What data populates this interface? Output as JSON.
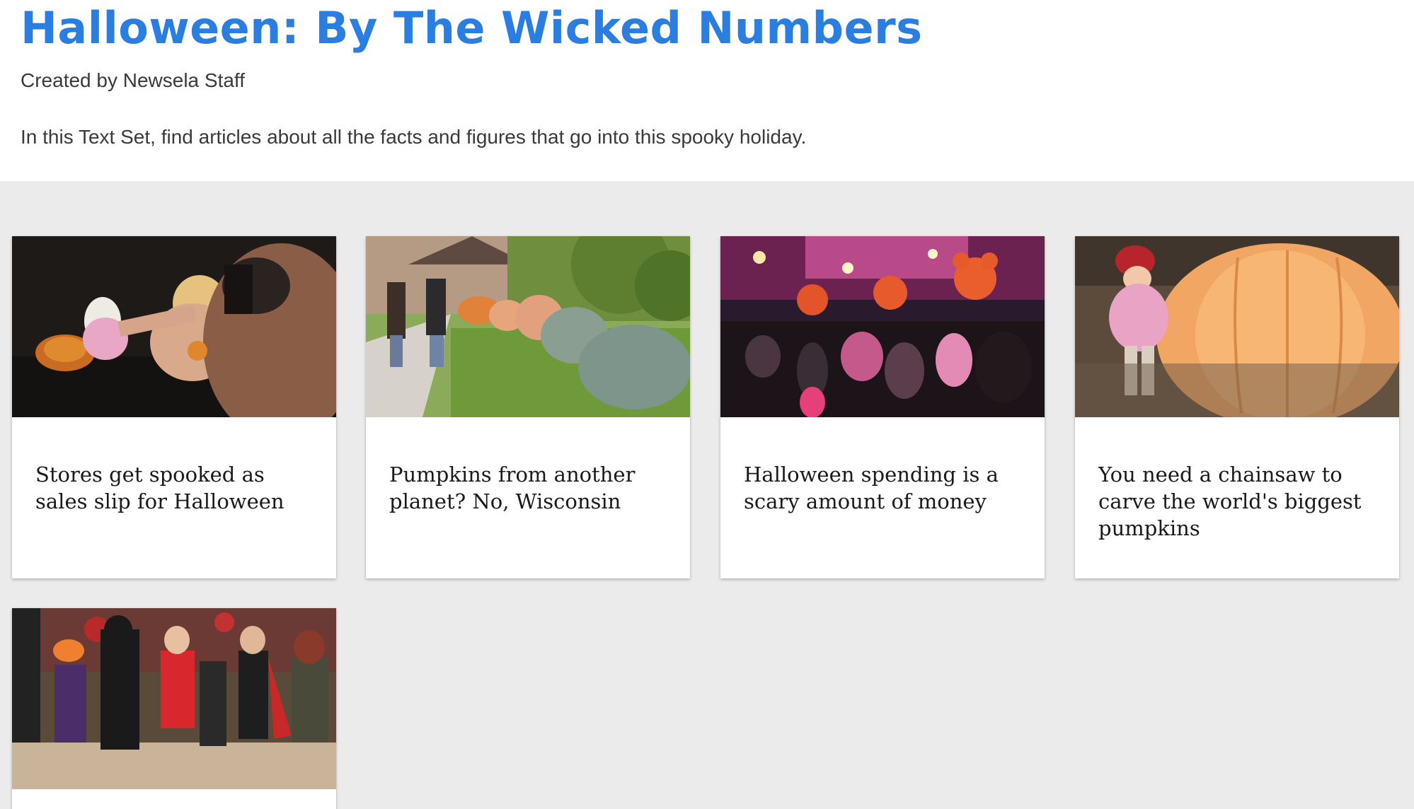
{
  "header": {
    "title": "Halloween: By The Wicked Numbers",
    "creator": "Created by Newsela Staff",
    "description": "In this Text Set, find articles about all the facts and figures that go into this spooky holiday."
  },
  "colors": {
    "title_blue": "#2a7de1",
    "grid_background": "#ebebeb",
    "card_background": "#ffffff"
  },
  "cards": [
    {
      "title": "Stores get spooked as sales slip for Halloween",
      "image_icon": "dog-costume-photo"
    },
    {
      "title": "Pumpkins from another planet? No, Wisconsin",
      "image_icon": "giant-pumpkins-lawn-photo"
    },
    {
      "title": "Halloween spending is a scary amount of money",
      "image_icon": "theme-park-halloween-crowd-photo"
    },
    {
      "title": "You need a chainsaw to carve the world's biggest pumpkins",
      "image_icon": "child-giant-pumpkin-photo"
    },
    {
      "title": "",
      "image_icon": "costume-group-photo"
    }
  ]
}
